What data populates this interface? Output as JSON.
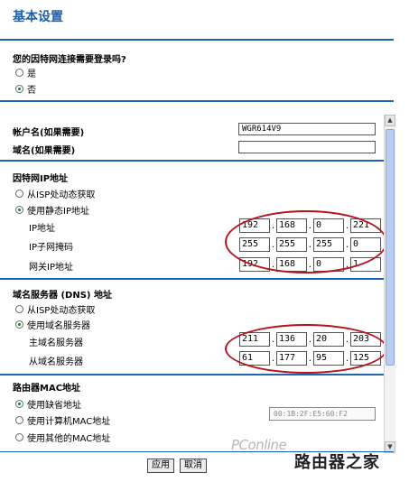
{
  "page": {
    "title": "基本设置"
  },
  "login_q": {
    "question": "您的因特网连接需要登录吗?",
    "options": [
      {
        "label": "是",
        "selected": false
      },
      {
        "label": "否",
        "selected": true
      }
    ]
  },
  "account": {
    "account_label": "帐户名(如果需要)",
    "account_value": "WGR614V9",
    "domain_label": "域名(如果需要)",
    "domain_value": ""
  },
  "internet_ip": {
    "heading": "因特网IP地址",
    "options": [
      {
        "label": "从ISP处动态获取",
        "selected": false
      },
      {
        "label": "使用静态IP地址",
        "selected": true
      }
    ],
    "ip_label": "IP地址",
    "ip": [
      "192",
      "168",
      "0",
      "221"
    ],
    "mask_label": "IP子网掩码",
    "mask": [
      "255",
      "255",
      "255",
      "0"
    ],
    "gateway_label": "网关IP地址",
    "gateway": [
      "192",
      "168",
      "0",
      "1"
    ]
  },
  "dns": {
    "heading": "域名服务器 (DNS) 地址",
    "options": [
      {
        "label": "从ISP处动态获取",
        "selected": false
      },
      {
        "label": "使用域名服务器",
        "selected": true
      }
    ],
    "primary_label": "主域名服务器",
    "primary": [
      "211",
      "136",
      "20",
      "203"
    ],
    "secondary_label": "从域名服务器",
    "secondary": [
      "61",
      "177",
      "95",
      "125"
    ]
  },
  "mac": {
    "heading": "路由器MAC地址",
    "options": [
      {
        "label": "使用缺省地址",
        "selected": true
      },
      {
        "label": "使用计算机MAC地址",
        "selected": false
      },
      {
        "label": "使用其他的MAC地址",
        "selected": false
      }
    ],
    "mac_value": "00:1B:2F:E5:60:F2"
  },
  "buttons": {
    "apply": "应用",
    "cancel": "取消"
  },
  "watermark": {
    "brand": "PConline",
    "site": "路由器之家"
  },
  "colors": {
    "accent": "#1f63b4",
    "annotation": "#b5141f",
    "radio_dot": "#0a8a27"
  }
}
